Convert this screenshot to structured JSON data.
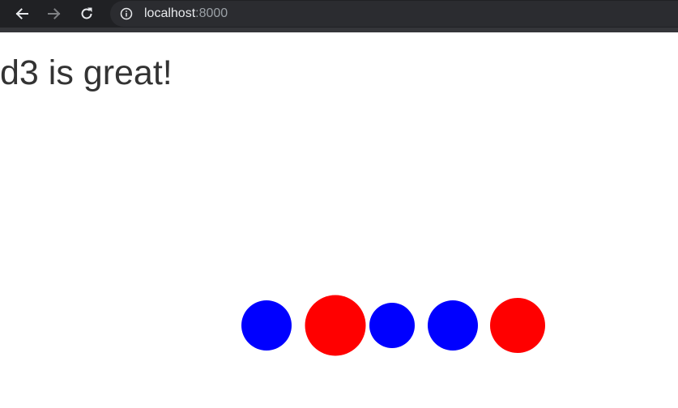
{
  "browser": {
    "url_host": "localhost",
    "url_port": ":8000",
    "icons": {
      "back": "back-arrow-icon",
      "forward": "forward-arrow-icon",
      "reload": "reload-icon",
      "site_info": "info-icon"
    }
  },
  "page": {
    "heading": "d3 is great!"
  },
  "colors": {
    "circle_colors": [
      "#0000ff",
      "#ff0000",
      "#0000ff",
      "#0000ff",
      "#ff0000"
    ]
  }
}
